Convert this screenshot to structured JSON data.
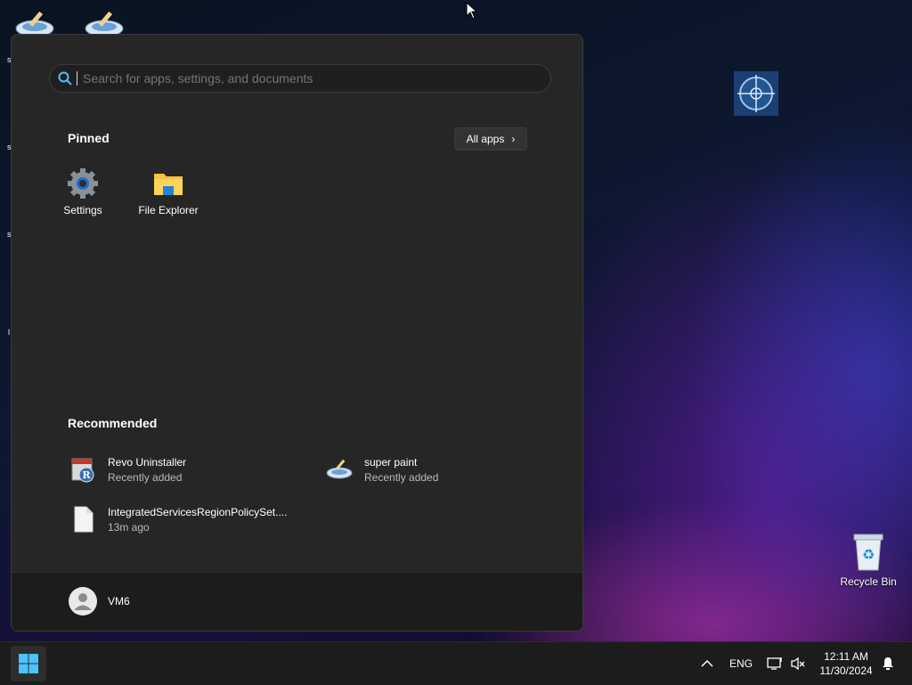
{
  "desktop": {
    "icons": [
      {
        "name": "paint-app-shortcut-1"
      },
      {
        "name": "paint-app-shortcut-2"
      }
    ],
    "recycle_bin_label": "Recycle Bin",
    "left_edge_marks": [
      "s",
      "s",
      "s",
      "l"
    ]
  },
  "start_menu": {
    "search_placeholder": "Search for apps, settings, and documents",
    "pinned_title": "Pinned",
    "all_apps_label": "All apps",
    "pinned": [
      {
        "label": "Settings",
        "icon": "settings-gear-icon"
      },
      {
        "label": "File Explorer",
        "icon": "folder-icon"
      }
    ],
    "recommended_title": "Recommended",
    "recommended": [
      {
        "name": "Revo Uninstaller",
        "sub": "Recently added",
        "icon": "revo-uninstaller-icon"
      },
      {
        "name": "super paint",
        "sub": "Recently added",
        "icon": "paint-icon"
      },
      {
        "name": "IntegratedServicesRegionPolicySet....",
        "sub": "13m ago",
        "icon": "file-icon"
      }
    ],
    "user_name": "VM6"
  },
  "taskbar": {
    "language": "ENG",
    "time": "12:11 AM",
    "date": "11/30/2024"
  },
  "colors": {
    "menu_bg": "#262626",
    "footer_bg": "#1c1c1c",
    "taskbar_bg": "#1c1c1c",
    "accent": "#0078d4"
  }
}
